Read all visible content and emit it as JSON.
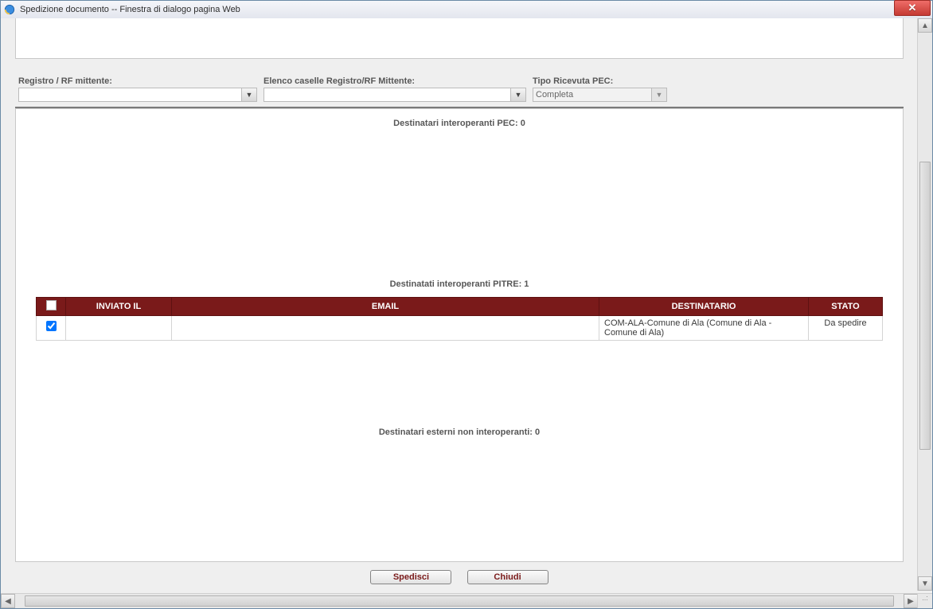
{
  "window": {
    "title": "Spedizione documento -- Finestra di dialogo pagina Web"
  },
  "filters": {
    "registro_label": "Registro / RF mittente:",
    "registro_value": "",
    "elenco_label": "Elenco caselle Registro/RF Mittente:",
    "elenco_value": "",
    "tipo_label": "Tipo Ricevuta PEC:",
    "tipo_value": "Completa"
  },
  "sections": {
    "pec_heading": "Destinatari interoperanti PEC: 0",
    "pitre_heading": "Destinatati interoperanti PITRE: 1",
    "noninterop_heading": "Destinatari esterni non interoperanti: 0"
  },
  "grid": {
    "col_inviato": "INVIATO IL",
    "col_email": "EMAIL",
    "col_dest": "DESTINATARIO",
    "col_stato": "STATO",
    "rows": [
      {
        "checked": true,
        "inviato_il": "",
        "email": "",
        "destinatario": "COM-ALA-Comune di Ala (Comune di Ala - Comune di Ala)",
        "stato": "Da spedire"
      }
    ]
  },
  "buttons": {
    "spedisci": "Spedisci",
    "chiudi": "Chiudi"
  }
}
